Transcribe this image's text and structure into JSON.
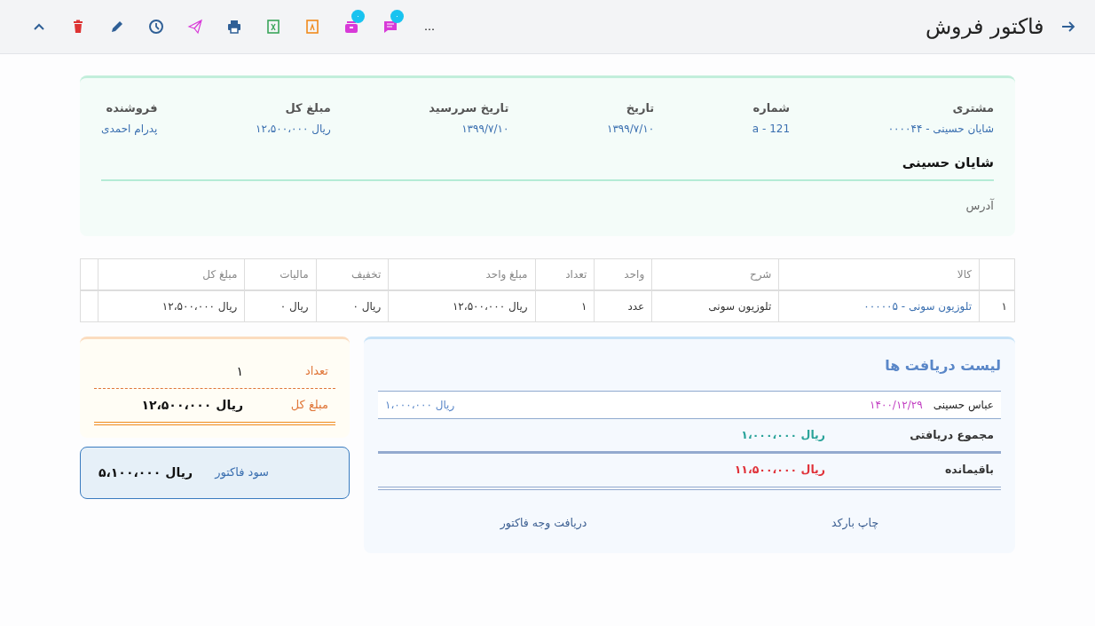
{
  "title": "فاکتور فروش",
  "toolbar": [
    {
      "kind": "more",
      "label": "…"
    },
    {
      "kind": "comments",
      "badge": "۰"
    },
    {
      "kind": "archive",
      "badge": "۰"
    },
    {
      "kind": "pdf"
    },
    {
      "kind": "excel"
    },
    {
      "kind": "print"
    },
    {
      "kind": "send"
    },
    {
      "kind": "history"
    },
    {
      "kind": "edit"
    },
    {
      "kind": "delete"
    },
    {
      "kind": "collapse"
    }
  ],
  "summary": {
    "fields": [
      {
        "label": "مشتری",
        "value": "شایان حسینی - ۰۰۰۰۴۴"
      },
      {
        "label": "شماره",
        "value": "121 - a"
      },
      {
        "label": "تاریخ",
        "value": "۱۳۹۹/۷/۱۰"
      },
      {
        "label": "تاریخ سررسید",
        "value": "۱۳۹۹/۷/۱۰"
      },
      {
        "label": "مبلغ کل",
        "value": "ریال ۱۲،۵۰۰،۰۰۰"
      },
      {
        "label": "فروشنده",
        "value": "پدرام احمدی"
      }
    ],
    "customer_name": "شایان حسینی",
    "address_label": "آدرس"
  },
  "table": {
    "columns": [
      "کالا",
      "شرح",
      "واحد",
      "تعداد",
      "مبلغ واحد",
      "تخفیف",
      "مالیات",
      "مبلغ کل"
    ],
    "rows": [
      {
        "number": "۱",
        "cells": [
          "تلوزیون سونی - ۰۰۰۰۰۵",
          "تلوزیون سونی",
          "عدد",
          "۱",
          "ریال ۱۲،۵۰۰،۰۰۰",
          "ریال ۰",
          "ریال ۰",
          "ریال ۱۲،۵۰۰،۰۰۰"
        ]
      }
    ]
  },
  "payments": {
    "title": "لیست دریافت ها",
    "receipts": [
      {
        "amount": "ریال ۱،۰۰۰،۰۰۰",
        "date": "۱۴۰۰/۱۲/۲۹",
        "payer": "عباس حسینی"
      }
    ],
    "total_received": {
      "label": "مجموع دریافتی",
      "value": "ریال ۱،۰۰۰،۰۰۰"
    },
    "remaining": {
      "label": "باقیمانده",
      "value": "ریال ۱۱،۵۰۰،۰۰۰"
    },
    "actions": [
      "چاپ بارکد",
      "دریافت وجه فاکتور"
    ]
  },
  "totals": {
    "count": {
      "label": "تعداد",
      "value": "۱"
    },
    "total": {
      "label": "مبلغ کل",
      "value": "ریال ۱۲،۵۰۰،۰۰۰"
    }
  },
  "profit": {
    "label": "سود فاکتور",
    "value": "ریال ۵،۱۰۰،۰۰۰"
  }
}
